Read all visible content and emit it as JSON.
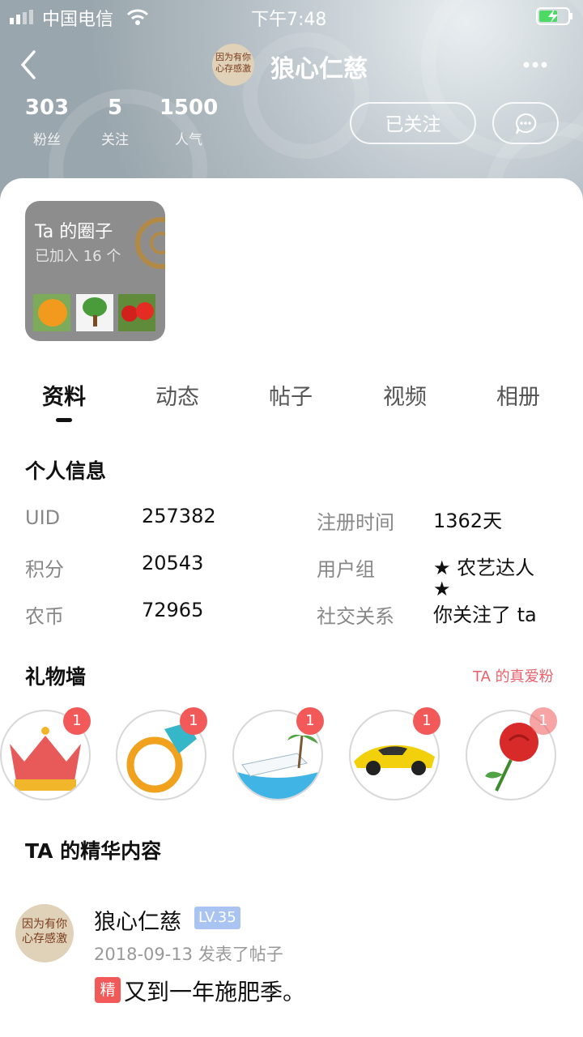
{
  "status_bar": {
    "carrier": "中国电信",
    "time": "下午7:48"
  },
  "header": {
    "username": "狼心仁慈",
    "avatar_text": [
      "因为有你",
      "心存感激"
    ]
  },
  "stats": [
    {
      "value": "303",
      "label": "粉丝"
    },
    {
      "value": "5",
      "label": "关注"
    },
    {
      "value": "1500",
      "label": "人气"
    }
  ],
  "actions": {
    "follow_label": "已关注"
  },
  "circle_card": {
    "title": "Ta 的圈子",
    "subtitle": "已加入 16 个"
  },
  "tabs": [
    "资料",
    "动态",
    "帖子",
    "视频",
    "相册"
  ],
  "personal_info": {
    "title": "个人信息",
    "left": [
      {
        "label": "UID",
        "value": "257382"
      },
      {
        "label": "积分",
        "value": "20543"
      },
      {
        "label": "农币",
        "value": "72965"
      }
    ],
    "right": [
      {
        "label": "注册时间",
        "value": "1362天"
      },
      {
        "label": "用户组",
        "value": "★ 农艺达人"
      },
      {
        "label": "",
        "value": "★"
      },
      {
        "label": "社交关系",
        "value": "你关注了 ta"
      }
    ]
  },
  "gift_wall": {
    "title": "礼物墙",
    "link": "TA 的真爱粉",
    "gifts": [
      {
        "icon": "crown-icon",
        "count": "1"
      },
      {
        "icon": "ring-icon",
        "count": "1"
      },
      {
        "icon": "yacht-icon",
        "count": "1"
      },
      {
        "icon": "sports-car-icon",
        "count": "1"
      },
      {
        "icon": "rose-icon",
        "count": "1"
      }
    ]
  },
  "featured": {
    "title": "TA 的精华内容",
    "post": {
      "author": "狼心仁慈",
      "level": "LV.35",
      "meta": "2018-09-13 发表了帖子",
      "tag": "精",
      "title": "又到一年施肥季。"
    }
  },
  "colors": {
    "accent_red": "#f25a5a",
    "level_badge": "#a9c4f0",
    "link_red": "#e8606b"
  }
}
